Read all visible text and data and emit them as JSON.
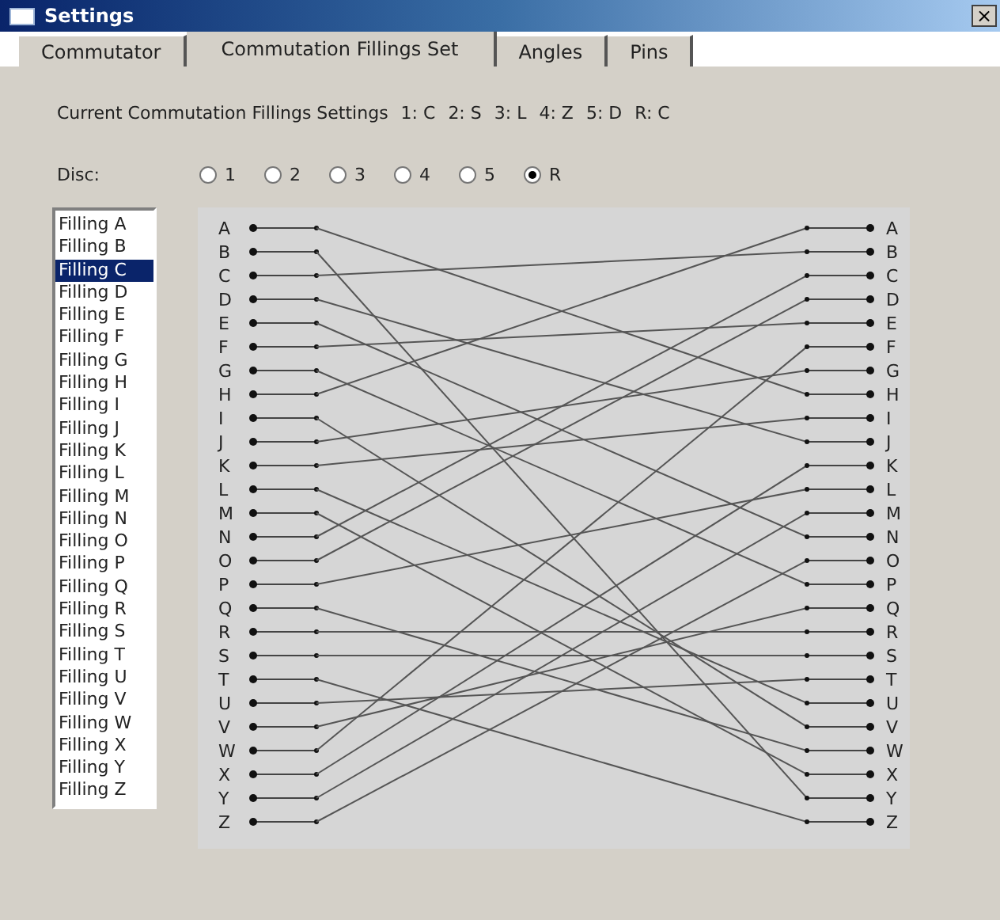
{
  "window": {
    "title": "Settings",
    "close": "×"
  },
  "tabs": [
    {
      "label": "Commutator",
      "selected": false
    },
    {
      "label": "Commutation Fillings Set",
      "selected": true
    },
    {
      "label": "Angles",
      "selected": false
    },
    {
      "label": "Pins",
      "selected": false
    }
  ],
  "current_settings": {
    "label": "Current Commutation Fillings Settings",
    "values": [
      "1: C",
      "2: S",
      "3: L",
      "4: Z",
      "5: D",
      "R: C"
    ]
  },
  "disc": {
    "label": "Disc:",
    "options": [
      {
        "label": "1",
        "selected": false
      },
      {
        "label": "2",
        "selected": false
      },
      {
        "label": "3",
        "selected": false
      },
      {
        "label": "4",
        "selected": false
      },
      {
        "label": "5",
        "selected": false
      },
      {
        "label": "R",
        "selected": true
      }
    ]
  },
  "fillings": [
    {
      "label": "Filling A",
      "selected": false
    },
    {
      "label": "Filling B",
      "selected": false
    },
    {
      "label": "Filling C",
      "selected": true
    },
    {
      "label": "Filling D",
      "selected": false
    },
    {
      "label": "Filling E",
      "selected": false
    },
    {
      "label": "Filling F",
      "selected": false
    },
    {
      "label": "Filling G",
      "selected": false
    },
    {
      "label": "Filling H",
      "selected": false
    },
    {
      "label": "Filling I",
      "selected": false
    },
    {
      "label": "Filling J",
      "selected": false
    },
    {
      "label": "Filling K",
      "selected": false
    },
    {
      "label": "Filling L",
      "selected": false
    },
    {
      "label": "Filling M",
      "selected": false
    },
    {
      "label": "Filling N",
      "selected": false
    },
    {
      "label": "Filling O",
      "selected": false
    },
    {
      "label": "Filling P",
      "selected": false
    },
    {
      "label": "Filling Q",
      "selected": false
    },
    {
      "label": "Filling R",
      "selected": false
    },
    {
      "label": "Filling S",
      "selected": false
    },
    {
      "label": "Filling T",
      "selected": false
    },
    {
      "label": "Filling U",
      "selected": false
    },
    {
      "label": "Filling V",
      "selected": false
    },
    {
      "label": "Filling W",
      "selected": false
    },
    {
      "label": "Filling X",
      "selected": false
    },
    {
      "label": "Filling Y",
      "selected": false
    },
    {
      "label": "Filling Z",
      "selected": false
    }
  ],
  "left_pins": [
    "A",
    "B",
    "C",
    "D",
    "E",
    "F",
    "G",
    "H",
    "I",
    "J",
    "K",
    "L",
    "M",
    "N",
    "O",
    "P",
    "Q",
    "R",
    "S",
    "T",
    "U",
    "V",
    "W",
    "X",
    "Y",
    "Z"
  ],
  "right_pins": [
    "A",
    "B",
    "C",
    "D",
    "E",
    "F",
    "G",
    "H",
    "I",
    "J",
    "K",
    "L",
    "M",
    "N",
    "O",
    "P",
    "Q",
    "R",
    "S",
    "T",
    "U",
    "V",
    "W",
    "X",
    "Y",
    "Z"
  ]
}
